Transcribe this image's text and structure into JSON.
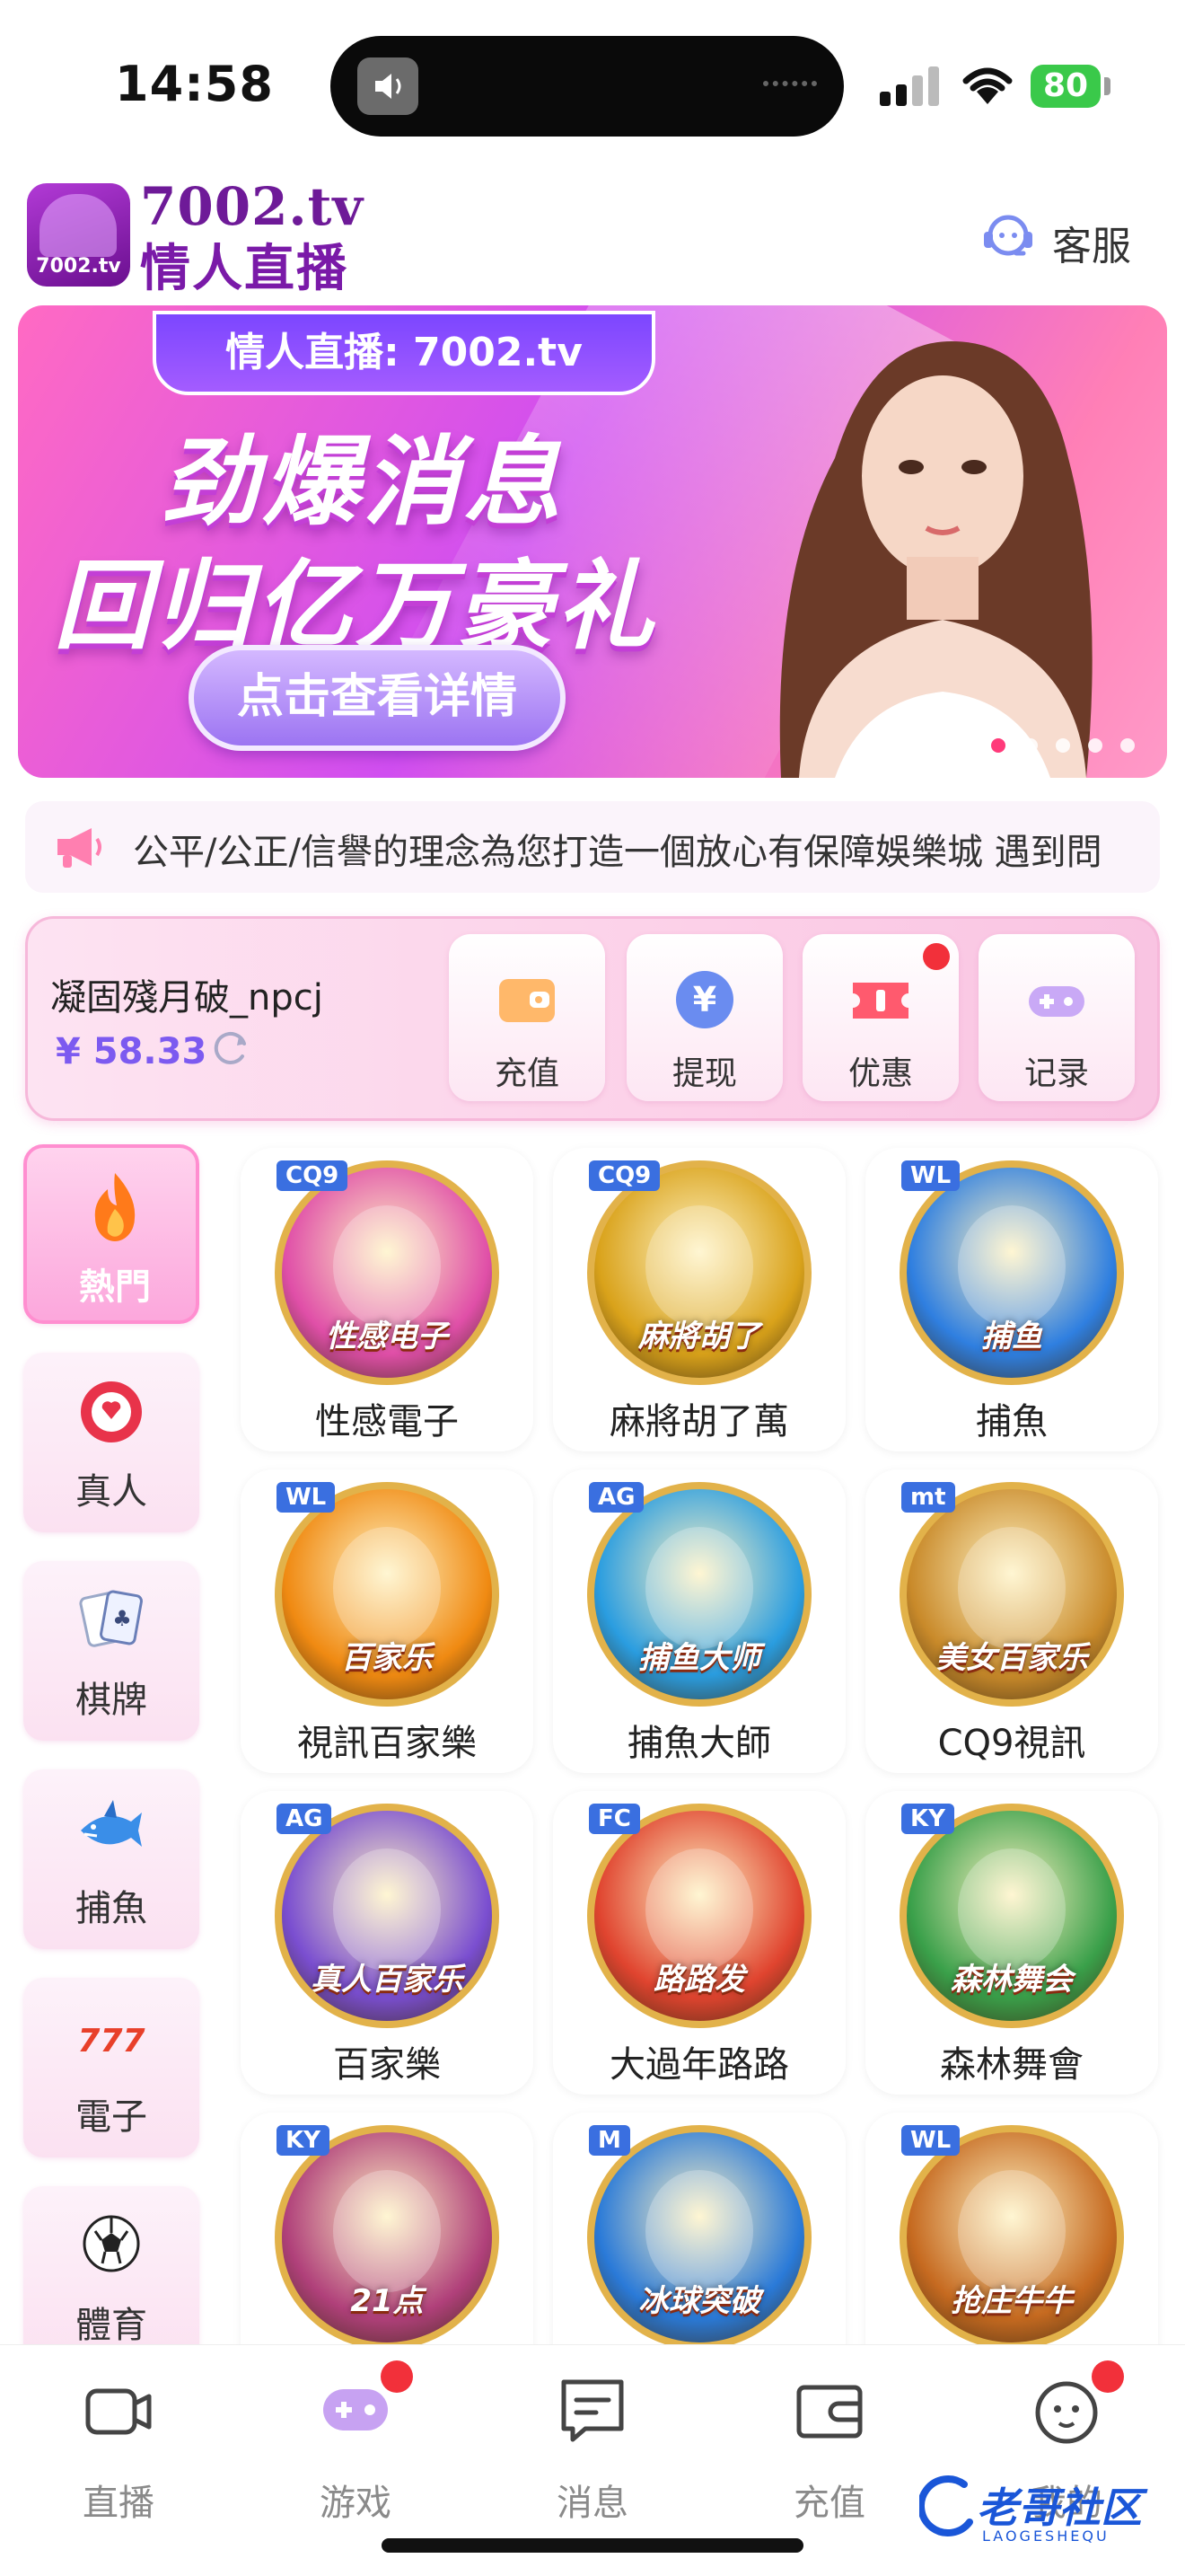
{
  "status_bar": {
    "time": "14:58",
    "battery": "80"
  },
  "header": {
    "logo_text": "7002.tv",
    "brand_line1": "7002.tv",
    "brand_line2": "情人直播",
    "service_label": "客服"
  },
  "banner": {
    "tag": "情人直播: 7002.tv",
    "headline1": "劲爆消息",
    "headline2": "回归亿万豪礼",
    "cta": "点击查看详情",
    "slide_count": 5,
    "active_slide": 1
  },
  "marquee": {
    "text": "公平/公正/信譽的理念為您打造一個放心有保障娛樂城  遇到問"
  },
  "account": {
    "username": "凝固殘月破_npcj",
    "balance": "¥ 58.33",
    "actions": [
      {
        "label": "充值",
        "icon": "wallet-icon",
        "badge": false
      },
      {
        "label": "提现",
        "icon": "yen-coin-icon",
        "badge": false
      },
      {
        "label": "优惠",
        "icon": "ticket-icon",
        "badge": true
      },
      {
        "label": "记录",
        "icon": "gamepad-icon",
        "badge": false
      }
    ]
  },
  "categories": [
    {
      "label": "熱門",
      "icon": "flame-icon",
      "active": true
    },
    {
      "label": "真人",
      "icon": "poker-chip-icon",
      "active": false
    },
    {
      "label": "棋牌",
      "icon": "playing-cards-icon",
      "active": false
    },
    {
      "label": "捕魚",
      "icon": "shark-icon",
      "active": false
    },
    {
      "label": "電子",
      "icon": "slot-777-icon",
      "active": false
    },
    {
      "label": "體育",
      "icon": "soccer-ball-icon",
      "active": false
    }
  ],
  "games": [
    {
      "label": "性感電子",
      "provider": "CQ9",
      "art": "性感电子",
      "color": "#e04fa8"
    },
    {
      "label": "麻將胡了萬",
      "provider": "CQ9",
      "art": "麻將胡了",
      "color": "#d9a21a"
    },
    {
      "label": "捕魚",
      "provider": "WL",
      "art": "捕鱼",
      "color": "#2f7fe0"
    },
    {
      "label": "視訊百家樂",
      "provider": "WL",
      "art": "百家乐",
      "color": "#f08a12"
    },
    {
      "label": "捕魚大師",
      "provider": "AG",
      "art": "捕鱼大师",
      "color": "#2a9de0"
    },
    {
      "label": "CQ9視訊",
      "provider": "mt",
      "art": "美女百家乐",
      "color": "#c98a2a"
    },
    {
      "label": "百家樂",
      "provider": "AG",
      "art": "真人百家乐",
      "color": "#7a4ed0"
    },
    {
      "label": "大過年路路",
      "provider": "FC",
      "art": "路路发",
      "color": "#e0442f"
    },
    {
      "label": "森林舞會",
      "provider": "KY",
      "art": "森林舞会",
      "color": "#3aa04a"
    },
    {
      "label": "",
      "provider": "KY",
      "art": "21点",
      "color": "#b0407a"
    },
    {
      "label": "",
      "provider": "M",
      "art": "冰球突破",
      "color": "#2a7ad8"
    },
    {
      "label": "",
      "provider": "WL",
      "art": "抢庄牛牛",
      "color": "#c66a20"
    }
  ],
  "bottom_nav": [
    {
      "label": "直播",
      "icon": "camera-icon",
      "badge": false
    },
    {
      "label": "游戏",
      "icon": "game-controller-icon",
      "badge": true
    },
    {
      "label": "消息",
      "icon": "message-icon",
      "badge": false
    },
    {
      "label": "充值",
      "icon": "wallet-icon",
      "badge": false
    },
    {
      "label": "我的",
      "icon": "profile-icon",
      "badge": true
    }
  ],
  "watermark": {
    "text": "老哥社区",
    "sub": "LAOGESHEQU"
  },
  "colors": {
    "accent": "#ff8ed0",
    "balance": "#7c5af0",
    "badge": "#f2303a"
  }
}
